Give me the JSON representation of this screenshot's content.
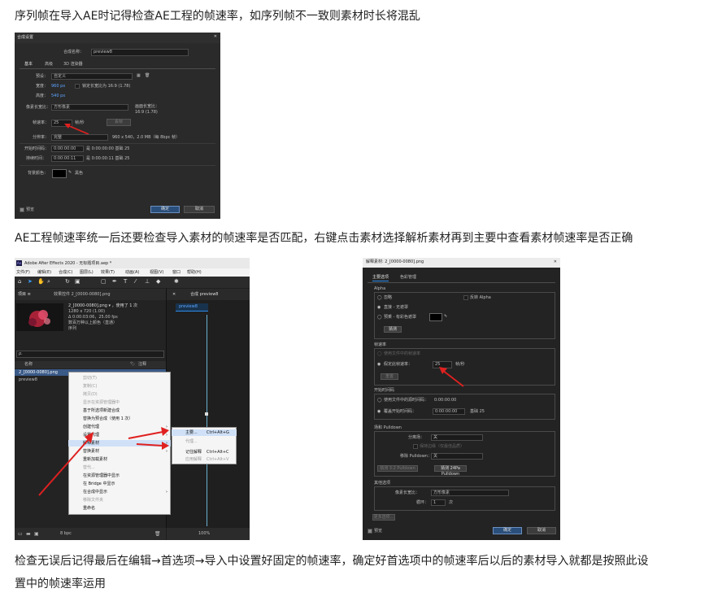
{
  "paragraphs": {
    "p1": "序列帧在导入AE时记得检查AE工程的帧速率，如序列帧不一致则素材时长将混乱",
    "p2": "AE工程帧速率统一后还要检查导入素材的帧速率是否匹配，右键点击素材选择解析素材再到主要中查看素材帧速率是否正确",
    "p3a": "检查无误后记得最后在编辑→首选项→导入中设置好固定的帧速率，确定好首选项中的帧速率后以后的素材导入就都是按照此设",
    "p3b": "置中的帧速率运用"
  },
  "comp_settings": {
    "title": "合成设置",
    "name_label": "合成名称：",
    "name_value": "preview8",
    "tabs": [
      "基本",
      "高级",
      "3D 渲染器"
    ],
    "preset_label": "预设：",
    "preset_value": "自定义",
    "width_label": "宽度：",
    "width_value": "960 px",
    "lock_label": "锁定长宽比为 16:9 (1.78)",
    "height_label": "高度：",
    "height_value": "540 px",
    "par_label": "像素长宽比：",
    "par_value": "方形像素",
    "frame_aspect_label": "画面长宽比：",
    "frame_aspect_value": "16:9 (1.78)",
    "fps_label": "帧速率：",
    "fps_value": "25",
    "fps_unit": "帧/秒",
    "drop_frame": "丢帧",
    "resolution_label": "分辨率：",
    "resolution_value": "完整",
    "resolution_info": "960 x 540，2.0 MB（每 8bpc 帧）",
    "start_tc_label": "开始时间码：",
    "start_tc_value": "0:00:00:00",
    "start_tc_info": "是 0:00:00:00 基础 25",
    "duration_label": "持续时间：",
    "duration_value": "0:00:00:11",
    "duration_info": "是 0:00:00:11 基础 25",
    "bg_label": "背景颜色：",
    "bg_value": "黑色",
    "preview_label": "预览",
    "ok": "确定",
    "cancel": "取消"
  },
  "ae_window": {
    "title": "Adobe After Effects 2020 - 无标题项目.aep *",
    "menu": [
      "文件(F)",
      "编辑(E)",
      "合成(C)",
      "图层(L)",
      "效果(T)",
      "动画(A)",
      "视图(V)",
      "窗口",
      "帮助(H)"
    ],
    "project_tab": "项目 ≡",
    "effects_tab": "效果控件 2_[0000-0080].png",
    "asset_name": "2_[0000-0080].png ▾ ，使用了 1 次",
    "asset_size": "1280 x 720 (1.00)",
    "asset_dur": "Δ 0:00:03:06，25.00 fps",
    "asset_color": "数百万种以上颜色（直通）",
    "asset_type": "序列",
    "search_placeholder": "ρ.",
    "col_name": "名称",
    "col_comment": "注释",
    "item1": "2_[0000-0080].png",
    "item2": "preview8",
    "comp_tab": "合成 preview8",
    "comp_sub": "preview8",
    "bpc": "8 bpc",
    "zoom": "100%",
    "context_menu": [
      {
        "label": "剪切(T)",
        "disabled": true
      },
      {
        "label": "复制(C)",
        "disabled": true
      },
      {
        "label": "拷贝(D)",
        "disabled": true
      },
      {
        "label": "显示在资源管理器中",
        "disabled": true
      },
      {
        "label": "基于所选项新建合成",
        "disabled": false
      },
      {
        "label": "替换为预合成（使用 1 次）",
        "disabled": false
      },
      {
        "label": "创建代理",
        "disabled": false,
        "sub": true
      },
      {
        "label": "设置代理",
        "disabled": false,
        "sub": true
      },
      {
        "label": "解释素材",
        "disabled": false,
        "sub": true,
        "highlight": true
      },
      {
        "label": "替换素材",
        "disabled": false,
        "sub": true
      },
      {
        "label": "重新加载素材",
        "disabled": false
      },
      {
        "label": "替代...",
        "disabled": true
      },
      {
        "label": "在资源管理器中显示",
        "disabled": false
      },
      {
        "label": "在 Bridge 中显示",
        "disabled": false
      },
      {
        "label": "在合成中显示",
        "disabled": false,
        "sub": true
      },
      {
        "label": "移除文件夹",
        "disabled": true
      },
      {
        "label": "重命名",
        "disabled": false
      }
    ],
    "submenu": [
      {
        "label": "主要...",
        "key": "Ctrl+Alt+G",
        "highlight": true
      },
      {
        "label": "代理...",
        "key": "",
        "disabled": true
      },
      {
        "label": "记住解释",
        "key": "Ctrl+Alt+C"
      },
      {
        "label": "应用解释",
        "key": "Ctrl+Alt+V",
        "disabled": true
      }
    ]
  },
  "interpret_dialog": {
    "title": "解释素材: 2_[0000-0080].png",
    "tabs": [
      "主要选项",
      "色彩管理"
    ],
    "alpha_section": "Alpha",
    "alpha_ignore": "忽略",
    "alpha_invert": "反转 Alpha",
    "alpha_straight": "直接 - 无遮罩",
    "alpha_premul": "预乘 - 有彩色遮罩",
    "guess": "猜测",
    "fps_section": "帧速率",
    "fps_from_file": "使用文件中的帧速率",
    "fps_assume": "假定此帧速率：",
    "fps_value": "25",
    "fps_unit": "帧/秒",
    "fps_reset": "重置",
    "tc_section": "开始时间码",
    "tc_from_file": "使用文件中的源时间码：",
    "tc_from_file_value": "0:00:00:00",
    "tc_override": "覆盖开始时间码：",
    "tc_override_value": "0:00:00:00",
    "tc_base": "基础 25",
    "fields_section": "场和 Pulldown",
    "separate_fields": "分离场：",
    "separate_fields_value": "关",
    "hq": "保持边缘（仅最佳品质）",
    "remove_pulldown": "移除 Pulldown：",
    "remove_pulldown_value": "关",
    "guess_3_2": "猜测 3:2 Pulldown",
    "guess_24pa": "猜测 24Pa Pulldown",
    "other_section": "其他选项",
    "par_label": "像素长宽比：",
    "par_value": "方形像素",
    "loop_label": "循环：",
    "loop_value": "1",
    "loop_unit": "次",
    "more_options": "更多选项...",
    "preview": "预览",
    "ok": "确定",
    "cancel": "取消"
  },
  "colors": {
    "arrow": "#e02020",
    "dialog_bg": "#232323",
    "accent": "#2d8ceb"
  }
}
